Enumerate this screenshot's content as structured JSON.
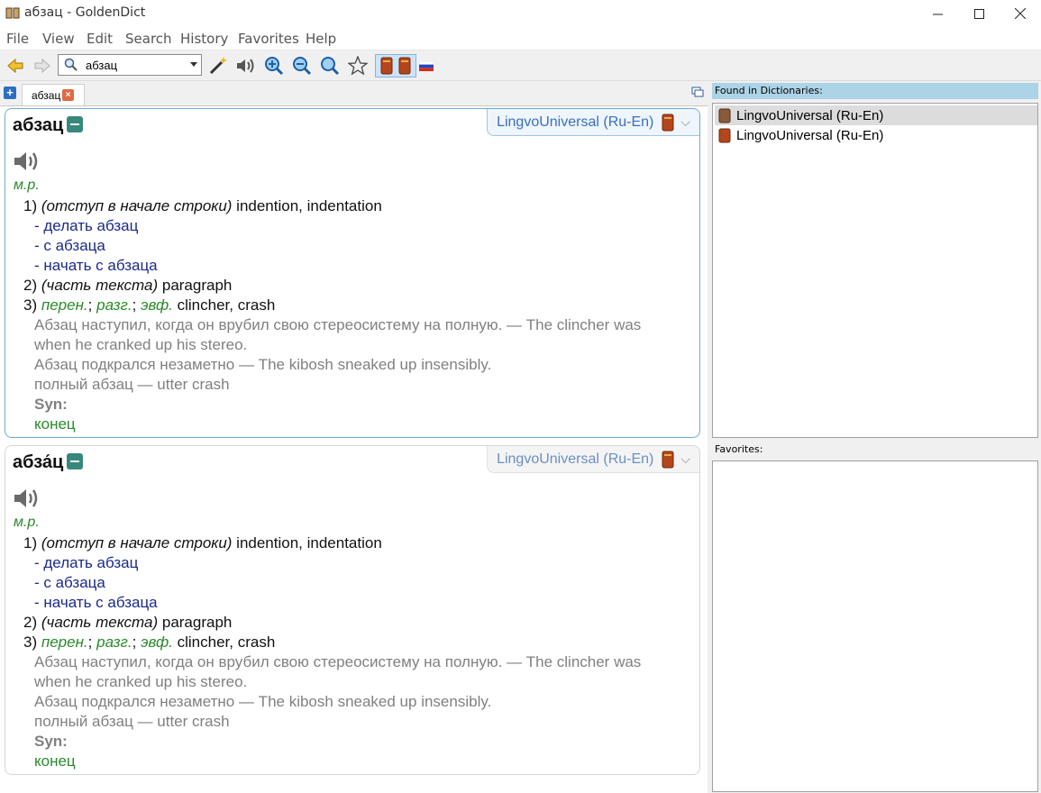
{
  "window": {
    "title": "абзац - GoldenDict",
    "icon": "book-icon",
    "controls": [
      "minimize-icon",
      "maximize-icon",
      "close-icon"
    ]
  },
  "menu": [
    "File",
    "View",
    "Edit",
    "Search",
    "History",
    "Favorites",
    "Help"
  ],
  "toolbar": {
    "search_value": "абзац",
    "icons": [
      "back-arrow-icon",
      "forward-arrow-icon",
      "magic-wand-icon",
      "speaker-icon",
      "zoom-in-icon",
      "zoom-out-icon",
      "zoom-reset-icon",
      "star-icon",
      "dictionary-group-icon",
      "dictionary-group-icon",
      "russian-flag-icon"
    ]
  },
  "tabs": [
    {
      "label": "абзац"
    }
  ],
  "articles": [
    {
      "headword": "абзац",
      "dictionary": "LingvoUniversal (Ru-En)",
      "pos": "м.р.",
      "senses": [
        {
          "num": "1)",
          "note": "(отступ в начале строки)",
          "text": " indention, indentation"
        },
        {
          "num": "2)",
          "note": "(часть текста)",
          "text": " paragraph"
        }
      ],
      "examples": [
        "- делать абзац",
        "- с абзаца",
        "- начать с абзаца"
      ],
      "sense3": {
        "num": "3)",
        "labels": [
          "перен.",
          "разг.",
          "эвф."
        ],
        "text": " clincher, crash"
      },
      "quotes": [
        "Абзац наступил, когда он врубил свою стереосистему на полную. — The clincher was",
        "when he cranked up his stereo.",
        "Абзац подкрался незаметно — The kibosh sneaked up insensibly.",
        "полный абзац — utter crash"
      ],
      "syn_label": "Syn:",
      "syn_word": "конец"
    },
    {
      "headword": "абза́ц",
      "dictionary": "LingvoUniversal (Ru-En)",
      "pos": "м.р.",
      "senses": [
        {
          "num": "1)",
          "note": "(отступ в начале строки)",
          "text": " indention, indentation"
        },
        {
          "num": "2)",
          "note": "(часть текста)",
          "text": " paragraph"
        }
      ],
      "examples": [
        "- делать абзац",
        "- с абзаца",
        "- начать с абзаца"
      ],
      "sense3": {
        "num": "3)",
        "labels": [
          "перен.",
          "разг.",
          "эвф."
        ],
        "text": " clincher, crash"
      },
      "quotes": [
        "Абзац наступил, когда он врубил свою стереосистему на полную. — The clincher was",
        "when he cranked up his stereo.",
        "Абзац подкрался незаметно — The kibosh sneaked up insensibly.",
        "полный абзац — utter crash"
      ],
      "syn_label": "Syn:",
      "syn_word": "конец"
    }
  ],
  "found_panel": {
    "title": "Found in Dictionaries:",
    "items": [
      "LingvoUniversal (Ru-En)",
      "LingvoUniversal (Ru-En)"
    ]
  },
  "favorites_panel": {
    "title": "Favorites:"
  },
  "colors": {
    "accent_blue": "#3c6fbf",
    "found_header": "#acd3e6",
    "pos_green": "#2a8a2a",
    "example_blue": "#1b2a8c"
  }
}
